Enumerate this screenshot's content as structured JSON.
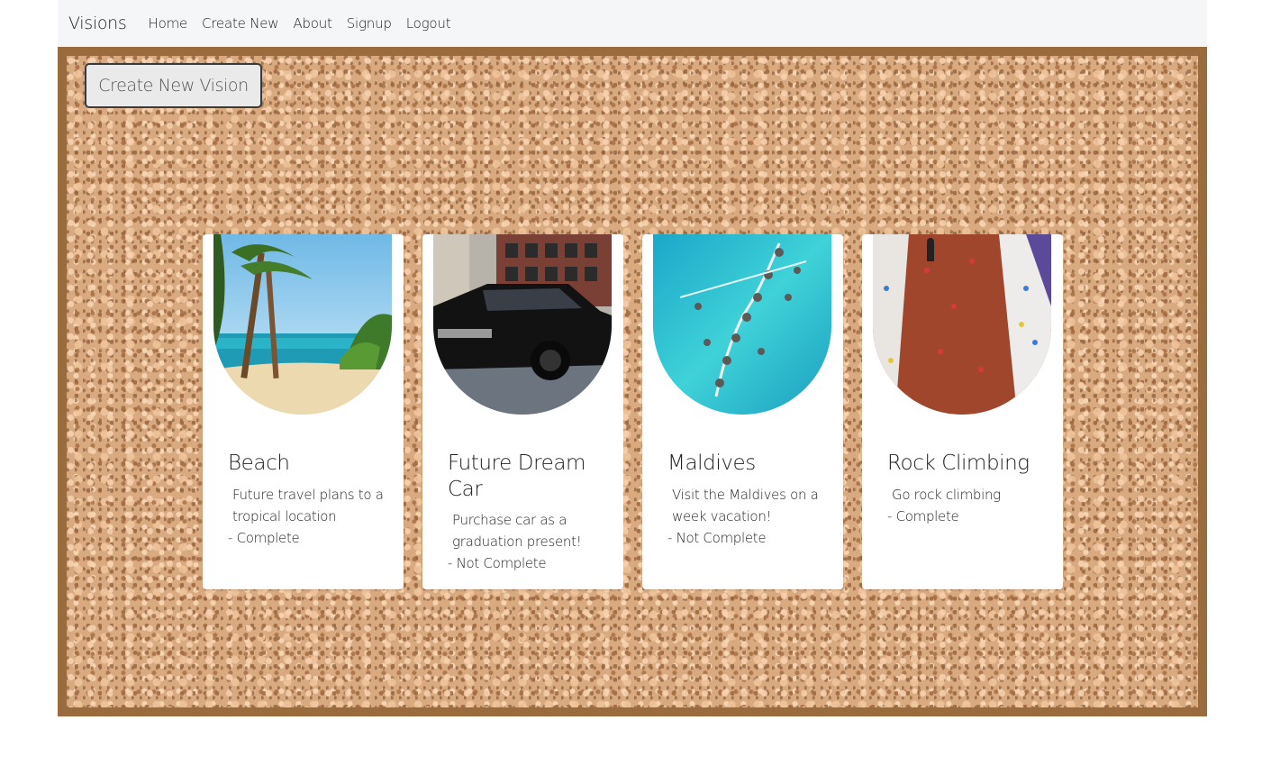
{
  "navbar": {
    "brand": "Visions",
    "links": [
      "Home",
      "Create New",
      "About",
      "Signup",
      "Logout"
    ]
  },
  "actions": {
    "create_label": "Create New Vision"
  },
  "cards": [
    {
      "title": "Beach",
      "description": "Future travel plans to a tropical location",
      "status": "- Complete",
      "image": "beach-palm-photo"
    },
    {
      "title": "Future Dream Car",
      "description": "Purchase car as a graduation present!",
      "status": "- Not Complete",
      "image": "black-sedan-photo"
    },
    {
      "title": "Maldives",
      "description": "Visit the Maldives on a week vacation!",
      "status": "- Not Complete",
      "image": "maldives-overwater-villas-photo"
    },
    {
      "title": "Rock Climbing",
      "description": "Go rock climbing",
      "status": "- Complete",
      "image": "climbing-wall-photo"
    }
  ],
  "colors": {
    "frame": "#9a6c3d",
    "cork": "#d9a97f",
    "navbar_bg": "#f5f6f8"
  }
}
